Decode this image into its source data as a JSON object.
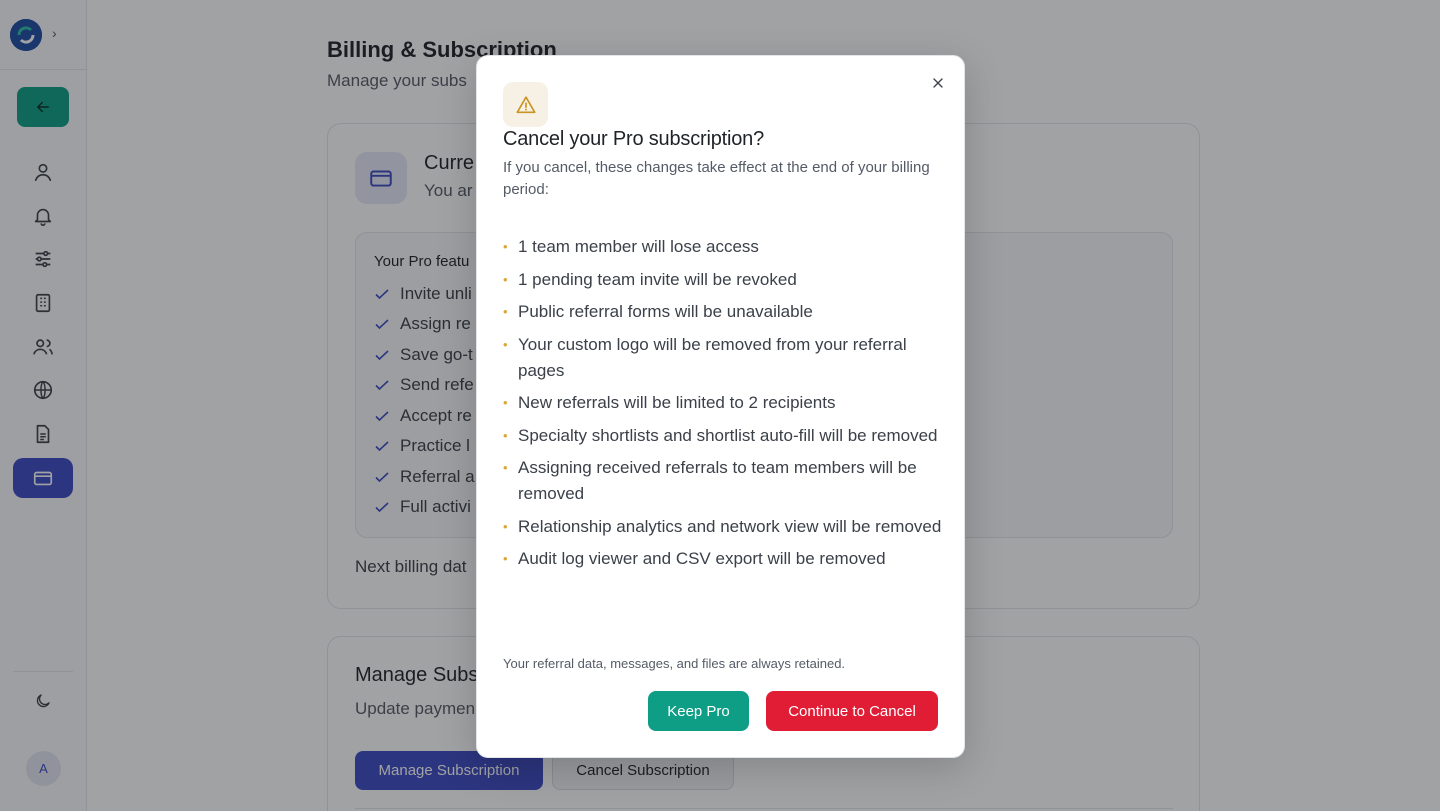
{
  "sidebar": {
    "avatar_initial": "A",
    "nav_items": [
      {
        "icon": "user-icon"
      },
      {
        "icon": "bell-icon"
      },
      {
        "icon": "sliders-icon"
      },
      {
        "icon": "building-icon"
      },
      {
        "icon": "users-icon"
      },
      {
        "icon": "globe-icon"
      },
      {
        "icon": "document-icon"
      },
      {
        "icon": "credit-card-icon",
        "active": true
      }
    ]
  },
  "page": {
    "title": "Billing & Subscription",
    "subtitle": "Manage your subs"
  },
  "current_plan": {
    "title": "Curre",
    "subtitle": "You ar",
    "features_title": "Your Pro featu",
    "features": [
      "Invite unli",
      "Assign re",
      "Save go-t",
      "Send refe",
      "Accept re",
      "Practice l",
      "Referral a",
      "Full activi"
    ],
    "next_billing": "Next billing dat"
  },
  "manage": {
    "title": "Manage Subs",
    "subtitle": "Update paymen",
    "manage_button": "Manage Subscription",
    "cancel_button": "Cancel Subscription"
  },
  "modal": {
    "title": "Cancel your Pro subscription?",
    "description": "If you cancel, these changes take effect at the end of your billing period:",
    "changes": [
      "1 team member will lose access",
      "1 pending team invite will be revoked",
      "Public referral forms will be unavailable",
      "Your custom logo will be removed from your referral pages",
      "New referrals will be limited to 2 recipients",
      "Specialty shortlists and shortlist auto-fill will be removed",
      "Assigning received referrals to team members will be removed",
      "Relationship analytics and network view will be removed",
      "Audit log viewer and CSV export will be removed"
    ],
    "retained_note": "Your referral data, messages, and files are always retained.",
    "keep_button": "Keep Pro",
    "continue_button": "Continue to Cancel"
  },
  "colors": {
    "accent": "#3d4ac2",
    "teal": "#0e9e86",
    "danger": "#e11d36",
    "warning": "#d9a73a"
  }
}
